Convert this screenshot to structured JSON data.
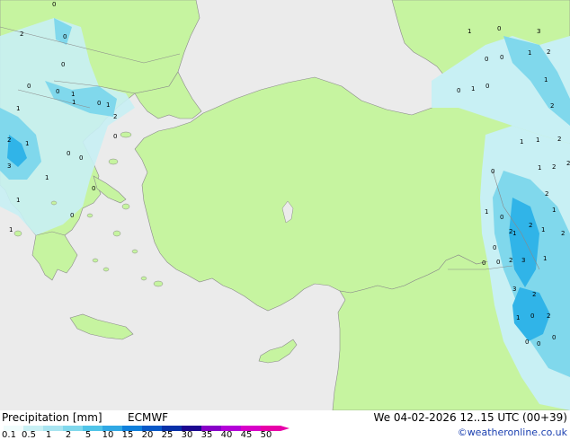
{
  "footer": {
    "title": "Precipitation [mm]",
    "model": "ECMWF",
    "valid_time": "We 04-02-2026 12..15 UTC (00+39)",
    "credit": "©weatheronline.co.uk"
  },
  "legend": {
    "labels": [
      "0.1",
      "0.5",
      "1",
      "2",
      "5",
      "10",
      "15",
      "20",
      "25",
      "30",
      "35",
      "40",
      "45",
      "50"
    ],
    "colors": [
      "#f0fcfc",
      "#c8f0f4",
      "#a8e4f0",
      "#80d8ec",
      "#50c4e8",
      "#30a8e4",
      "#1080dc",
      "#0858c8",
      "#0830a8",
      "#1c0890",
      "#8800c8",
      "#b400d8",
      "#d800c8",
      "#e800a8"
    ]
  },
  "colors": {
    "sea": "#ebebeb",
    "land": "#c6f4a0",
    "precip_light": "#c8f0f4",
    "precip_moderate": "#80d8ec",
    "precip_heavy": "#30b4e8",
    "border": "#8a8a8a"
  },
  "map_values": [
    "0",
    "0",
    "0",
    "1",
    "2",
    "1",
    "2",
    "1",
    "3",
    "1",
    "1",
    "2",
    "3",
    "2",
    "1",
    "1",
    "2",
    "2",
    "1",
    "1",
    "2",
    "2",
    "1",
    "2",
    "1",
    "2",
    "2",
    "1",
    "2",
    "3",
    "1",
    "3",
    "2",
    "2",
    "0",
    "1",
    "0",
    "0",
    "0",
    "1",
    "0",
    "1",
    "0",
    "0",
    "0",
    "2",
    "1",
    "0",
    "0",
    "1",
    "0",
    "0",
    "0",
    "0",
    "1",
    "0",
    "0",
    "1",
    "0",
    "0",
    "0",
    "0",
    "1",
    "0",
    "0"
  ]
}
